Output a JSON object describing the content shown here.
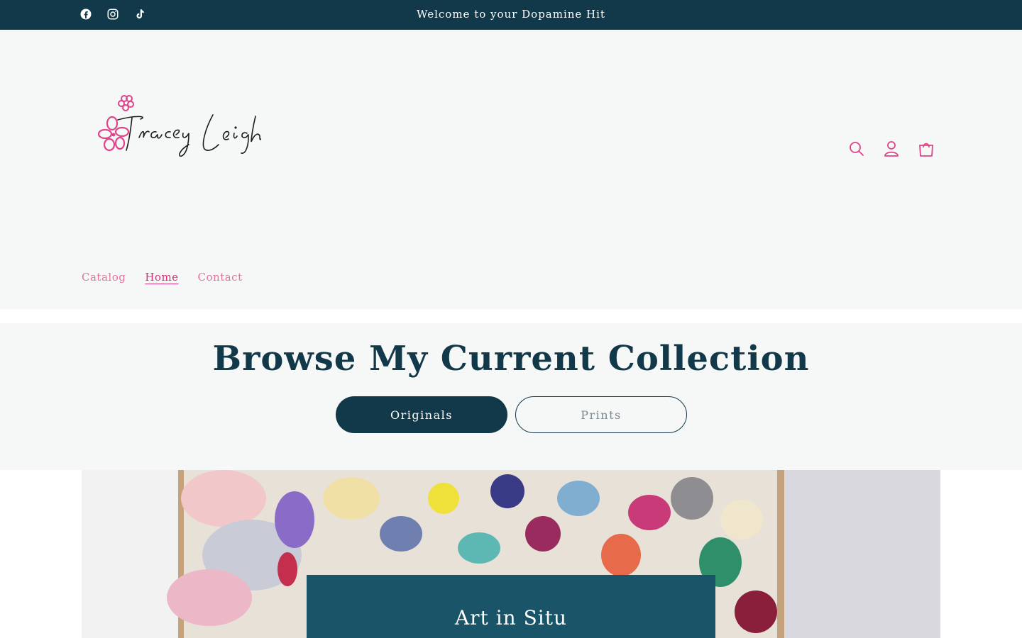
{
  "announcement": {
    "text": "Welcome to your Dopamine Hit",
    "social_icons": [
      "facebook-icon",
      "instagram-icon",
      "tiktok-icon"
    ]
  },
  "header": {
    "logo_text": "Tracey Leigh",
    "icons": [
      "search-icon",
      "account-icon",
      "cart-icon"
    ]
  },
  "nav": {
    "items": [
      {
        "label": "Catalog",
        "active": false
      },
      {
        "label": "Home",
        "active": true
      },
      {
        "label": "Contact",
        "active": false
      }
    ]
  },
  "collection": {
    "title": "Browse My Current Collection",
    "primary_button": "Originals",
    "secondary_button": "Prints"
  },
  "hero": {
    "title": "Art in Situ"
  },
  "colors": {
    "brand_dark": "#12394a",
    "accent_pink": "#e0749f",
    "hero_box": "#1a5468",
    "background": "#f6f7f7"
  }
}
